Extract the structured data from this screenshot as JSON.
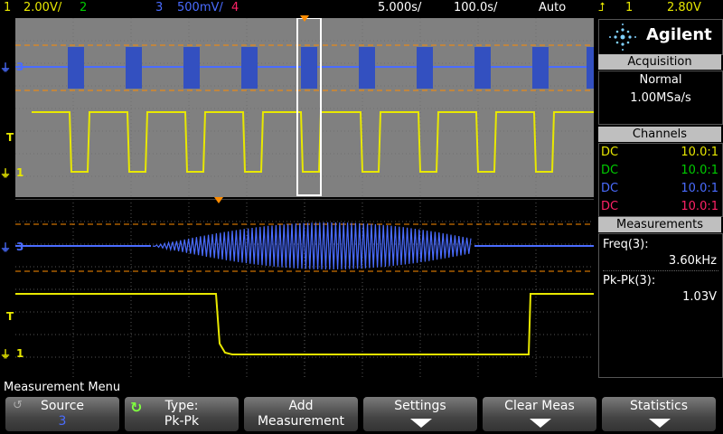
{
  "topbar": {
    "ch1_label": "1",
    "ch1_scale": "2.00V/",
    "ch2_label": "2",
    "ch3_label": "3",
    "ch3_scale": "500mV/",
    "ch4_label": "4",
    "timebase": "5.000s/",
    "delay": "100.0s/",
    "trigger_mode": "Auto",
    "trigger_source": "1",
    "trigger_level": "2.80V",
    "trigger_icon": "trigger-edge-icon"
  },
  "brand": {
    "name": "Agilent",
    "logo_icon": "agilent-spark-icon"
  },
  "acquisition": {
    "title": "Acquisition",
    "mode": "Normal",
    "rate": "1.00MSa/s"
  },
  "channels": {
    "title": "Channels",
    "rows": [
      {
        "coupling": "DC",
        "probe": "10.0:1",
        "color": "#e8e800"
      },
      {
        "coupling": "DC",
        "probe": "10.0:1",
        "color": "#00cc00"
      },
      {
        "coupling": "DC",
        "probe": "10.0:1",
        "color": "#4a6cff"
      },
      {
        "coupling": "DC",
        "probe": "10.0:1",
        "color": "#ff2266"
      }
    ]
  },
  "measurements": {
    "title": "Measurements",
    "items": [
      {
        "label": "Freq(3):",
        "value": "3.60kHz"
      },
      {
        "label": "Pk-Pk(3):",
        "value": "1.03V"
      }
    ]
  },
  "waveform_markers": {
    "ch1": "1",
    "ch3": "3",
    "trigger": "T"
  },
  "menu": {
    "title": "Measurement Menu",
    "softkeys": [
      {
        "line1": "Source",
        "line2": "3"
      },
      {
        "line1": "Type:",
        "line2": "Pk-Pk"
      },
      {
        "line1": "Add",
        "line2": "Measurement"
      },
      {
        "line1": "Settings",
        "line2": ""
      },
      {
        "line1": "Clear Meas",
        "line2": ""
      },
      {
        "line1": "Statistics",
        "line2": ""
      }
    ]
  },
  "colors": {
    "ch1": "#e8e800",
    "ch2": "#00cc00",
    "ch3": "#4a6cff",
    "ch4": "#ff2266",
    "trigger": "#ff8c00"
  }
}
